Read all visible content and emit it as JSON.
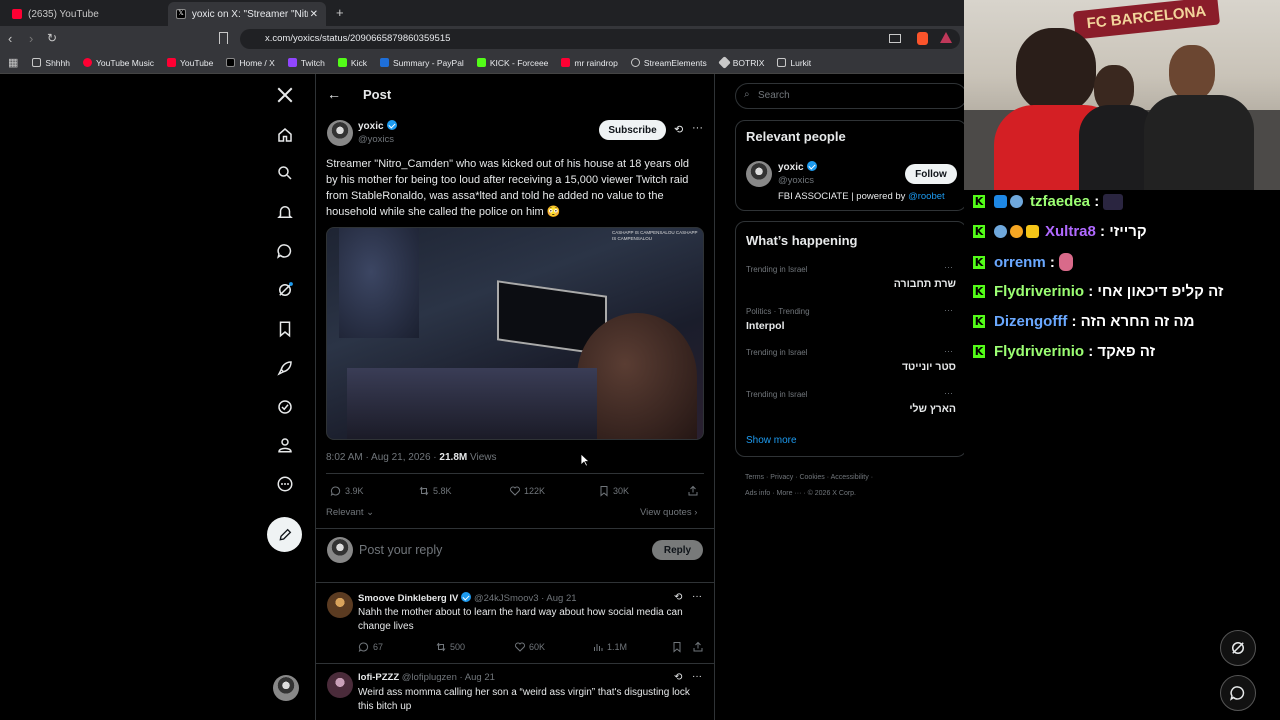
{
  "browser": {
    "tabs": [
      {
        "label": "(2635) YouTube",
        "active": false
      },
      {
        "label": "yoxic on X: \"Streamer \"Nitro_C...",
        "active": true
      }
    ],
    "url": "x.com/yoxics/status/2090665879860359515",
    "bookmarks": [
      "Shhhh",
      "YouTube Music",
      "YouTube",
      "Home / X",
      "Twitch",
      "Kick",
      "Summary - PayPal",
      "KICK - Forceee",
      "mr raindrop",
      "StreamElements",
      "BOTRIX",
      "Lurkit"
    ]
  },
  "header": {
    "title": "Post"
  },
  "post": {
    "author_name": "yoxic",
    "author_handle": "@yoxics",
    "subscribe_label": "Subscribe",
    "text": "Streamer \"Nitro_Camden\" who was kicked out of his house at 18 years old by his mother for being too loud after receiving a 15,000 viewer Twitch raid from StableRonaldo, was assa*lted and told he added no value to the household while she called the police on him 😳",
    "image_overlay": "CASHAPP IS CAMPENSALOU CASHAPP IS CAMPENSALOU",
    "timestamp": "8:02 AM · Aug 21, 2026 · ",
    "views_count": "21.8M",
    "views_label": "Views",
    "replies": "3.9K",
    "reposts": "5.8K",
    "likes": "122K",
    "bookmarks": "30K",
    "sort_label": "Relevant",
    "view_quotes": "View quotes"
  },
  "composer": {
    "placeholder": "Post your reply",
    "reply_label": "Reply"
  },
  "replies": [
    {
      "name": "Smoove Dinkleberg IV",
      "handle": "@24kJSmoov3",
      "date": "· Aug 21",
      "text": "Nahh the mother about to learn the hard way about how social media can change lives",
      "replies": "67",
      "reposts": "500",
      "likes": "60K",
      "views": "1.1M"
    },
    {
      "name": "lofi-PZZZ",
      "handle": "@lofiplugzen",
      "date": "· Aug 21",
      "text": "Weird ass momma calling her son a “weird ass virgin” that's disgusting lock this bitch up"
    }
  ],
  "search": {
    "placeholder": "Search"
  },
  "relevant": {
    "title": "Relevant people",
    "name": "yoxic",
    "handle": "@yoxics",
    "follow_label": "Follow",
    "bio_prefix": "FBI ASSOCIATE | powered by ",
    "bio_link": "@roobet"
  },
  "happening": {
    "title": "What’s happening",
    "trends": [
      {
        "context": "Trending in Israel",
        "name": "שרת תחבורה",
        "rtl": true
      },
      {
        "context": "Politics · Trending",
        "name": "Interpol",
        "rtl": false
      },
      {
        "context": "Trending in Israel",
        "name": "סטר יונייטד",
        "rtl": true
      },
      {
        "context": "Trending in Israel",
        "name": "הארץ שלי",
        "rtl": true
      }
    ],
    "show_more": "Show more"
  },
  "footer": {
    "links": [
      "Terms",
      "Privacy",
      "Cookies",
      "Accessibility",
      "Ads info",
      "More ···"
    ],
    "copyright": "© 2026 X Corp."
  },
  "webcam": {
    "banner": "FC BARCELONA"
  },
  "chat": [
    {
      "user": "tzfaedea",
      "color": "#9cff73",
      "message": ""
    },
    {
      "user": "Xultra8",
      "color": "#b069ff",
      "message": "קרייזי"
    },
    {
      "user": "orrenm",
      "color": "#6aa8ff",
      "message": ""
    },
    {
      "user": "Flydriverinio",
      "color": "#9cff73",
      "message": "זה קליפ דיכאון אחי"
    },
    {
      "user": "Dizengofff",
      "color": "#6aa8ff",
      "message": "מה זה החרא הזה"
    },
    {
      "user": "Flydriverinio",
      "color": "#9cff73",
      "message": "זה פאקד"
    }
  ],
  "colors": {
    "accent": "#1d9bf0",
    "kick_green": "#53fc18"
  }
}
